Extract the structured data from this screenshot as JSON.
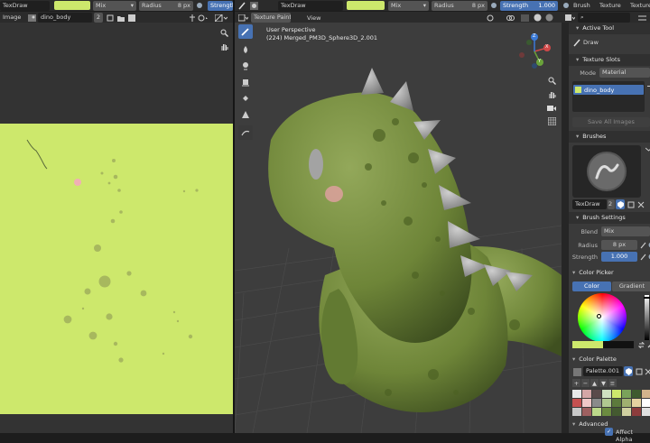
{
  "top_left": {
    "brush_name": "TexDraw",
    "color_hex": "#cde86c",
    "blend": "Mix",
    "radius_label": "Radius",
    "radius_value": "8 px",
    "strength_label": "Strength"
  },
  "image_editor": {
    "menu_label": "Image",
    "image_name": "dino_body",
    "users_count": "2"
  },
  "viewport_header": {
    "brush_name": "TexDraw",
    "mode_label": "Texture Paint",
    "view_label": "View",
    "color_hex": "#cde86c",
    "blend": "Mix",
    "radius_label": "Radius",
    "radius_value": "8 px",
    "strength_label": "Strength",
    "strength_value": "1.000",
    "menu_brush": "Brush",
    "menu_texture": "Texture",
    "menu_texture2": "Texture"
  },
  "viewport": {
    "perspective_label": "User Perspective",
    "object_label": "(224) Merged_PM3D_Sphere3D_2.001",
    "gizmo": {
      "x": "X",
      "y": "Y",
      "z": "Z"
    }
  },
  "properties": {
    "active_tool": {
      "header": "Active Tool",
      "tool_name": "Draw"
    },
    "texture_slots": {
      "header": "Texture Slots",
      "mode_label": "Mode",
      "mode_value": "Material",
      "slot_name": "dino_body",
      "save_button": "Save All Images"
    },
    "brushes": {
      "header": "Brushes",
      "brush_name": "TexDraw",
      "users": "2"
    },
    "brush_settings": {
      "header": "Brush Settings",
      "blend_label": "Blend",
      "blend_value": "Mix",
      "radius_label": "Radius",
      "radius_value": "8 px",
      "strength_label": "Strength",
      "strength_value": "1.000"
    },
    "color_picker": {
      "header": "Color Picker",
      "tab_color": "Color",
      "tab_gradient": "Gradient"
    },
    "color_palette": {
      "header": "Color Palette",
      "palette_name": "Palette.001"
    },
    "advanced": {
      "header": "Advanced",
      "affect_alpha": "Affect Alpha"
    }
  },
  "palette_swatches": [
    "#e8e8e8",
    "#d4a6a6",
    "#5a4a4a",
    "#cfe0c0",
    "#cde86c",
    "#7aa25a",
    "#3e5a2e",
    "#d2b48c",
    "#c45050",
    "#f0c8c8",
    "#8a8a8a",
    "#b0c890",
    "#5c7a3c",
    "#a0b070",
    "#e4d2a0",
    "#ffffff",
    "#c8c8c8",
    "#9e6060",
    "#bcd88a",
    "#6c8c40",
    "#445a30",
    "#d0d0a0",
    "#8c3c3c",
    "#e0e0e0"
  ],
  "colors": {
    "accent": "#4772b3",
    "paint": "#cde86c"
  }
}
